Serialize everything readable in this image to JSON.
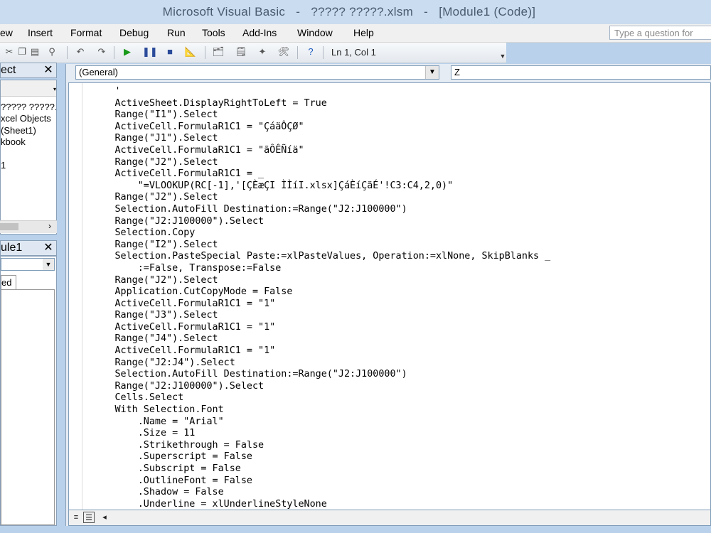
{
  "window": {
    "title": "Microsoft Visual Basic",
    "file": "????? ?????.xlsm",
    "module": "[Module1 (Code)]"
  },
  "menu": [
    "ew",
    "Insert",
    "Format",
    "Debug",
    "Run",
    "Tools",
    "Add-Ins",
    "Window",
    "Help"
  ],
  "help_placeholder": "Type a question for",
  "toolbar": {
    "status": "Ln 1, Col 1",
    "icons": [
      "cut-icon",
      "copy-icon",
      "paste-icon",
      "find-icon",
      "undo-icon",
      "redo-icon",
      "run-icon",
      "break-icon",
      "reset-icon",
      "design-mode-icon",
      "project-explorer-icon",
      "properties-icon",
      "object-browser-icon",
      "toolbox-icon",
      "help-icon"
    ]
  },
  "project_pane": {
    "title": "ect",
    "lines": [
      "????? ?????.",
      "xcel Objects",
      "(Sheet1)",
      "kbook",
      "1"
    ]
  },
  "properties_pane": {
    "title": "ule1",
    "tab": "ed"
  },
  "code_window": {
    "object_combo": "(General)",
    "procedure_combo": "Z",
    "code": "        '\n        ActiveSheet.DisplayRightToLeft = True\n        Range(\"I1\").Select\n        ActiveCell.FormulaR1C1 = \"ÇáäÔÇØ\"\n        Range(\"J1\").Select\n        ActiveCell.FormulaR1C1 = \"ãÔÊÑíä\"\n        Range(\"J2\").Select\n        ActiveCell.FormulaR1C1 = _\n            \"=VLOOKUP(RC[-1],'[ÇÈæÇI ÌÌíI.xlsx]ÇáÈíÇäÉ'!C3:C4,2,0)\"\n        Range(\"J2\").Select\n        Selection.AutoFill Destination:=Range(\"J2:J100000\")\n        Range(\"J2:J100000\").Select\n        Selection.Copy\n        Range(\"I2\").Select\n        Selection.PasteSpecial Paste:=xlPasteValues, Operation:=xlNone, SkipBlanks _\n            :=False, Transpose:=False\n        Range(\"J2\").Select\n        Application.CutCopyMode = False\n        ActiveCell.FormulaR1C1 = \"1\"\n        Range(\"J3\").Select\n        ActiveCell.FormulaR1C1 = \"1\"\n        Range(\"J4\").Select\n        ActiveCell.FormulaR1C1 = \"1\"\n        Range(\"J2:J4\").Select\n        Selection.AutoFill Destination:=Range(\"J2:J100000\")\n        Range(\"J2:J100000\").Select\n        Cells.Select\n        With Selection.Font\n            .Name = \"Arial\"\n            .Size = 11\n            .Strikethrough = False\n            .Superscript = False\n            .Subscript = False\n            .OutlineFont = False\n            .Shadow = False\n            .Underline = xlUnderlineStyleNone"
  }
}
